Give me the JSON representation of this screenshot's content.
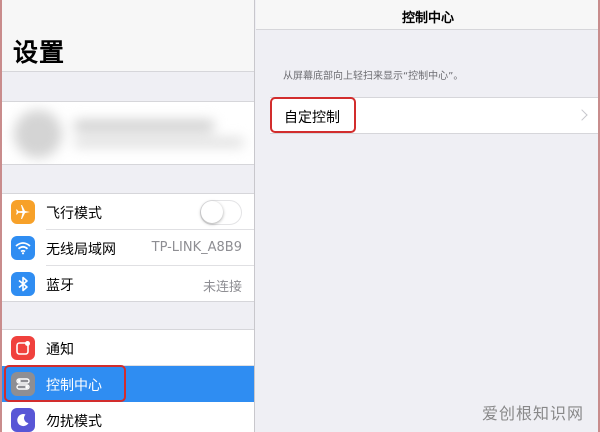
{
  "sidebar": {
    "title": "设置",
    "group1": [
      {
        "label": "飞行模式",
        "icon": "airplane-icon",
        "color": "#f7a129",
        "type": "toggle",
        "toggle_on": false
      },
      {
        "label": "无线局域网",
        "icon": "wifi-icon",
        "color": "#2f8df2",
        "type": "value",
        "value": "TP-LINK_A8B9"
      },
      {
        "label": "蓝牙",
        "icon": "bluetooth-icon",
        "color": "#2f8df2",
        "type": "value",
        "value": "未连接"
      }
    ],
    "group2": [
      {
        "label": "通知",
        "icon": "notifications-icon",
        "color": "#f0413d"
      },
      {
        "label": "控制中心",
        "icon": "control-center-icon",
        "color": "#8e8e93",
        "selected": true
      },
      {
        "label": "勿扰模式",
        "icon": "moon-icon",
        "color": "#5856d6"
      }
    ]
  },
  "detail": {
    "title": "控制中心",
    "caption": "从屏幕底部向上轻扫来显示“控制中心”。",
    "cell_label": "自定控制"
  },
  "watermark": "爱创根知识网",
  "colors": {
    "accent": "#2f8df2",
    "highlight": "#d22d2d"
  }
}
